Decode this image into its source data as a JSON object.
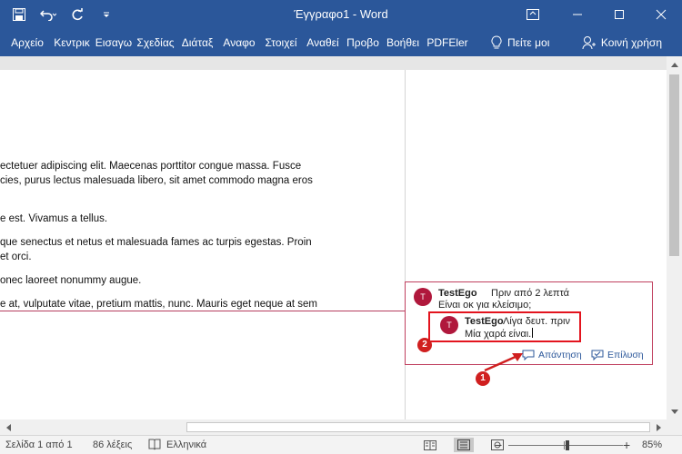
{
  "window": {
    "title": "Έγγραφο1 - Word"
  },
  "ribbon": {
    "tabs": [
      "Αρχείο",
      "Κεντρικ",
      "Εισαγω",
      "Σχεδίας",
      "Διάταξ",
      "Αναφο",
      "Στοιχεί",
      "Αναθεί",
      "Προβο",
      "Βοήθει",
      "PDFEler"
    ],
    "tell_me": "Πείτε μοι",
    "share": "Κοινή χρήση"
  },
  "document": {
    "lines": [
      "ectetuer adipiscing elit. Maecenas porttitor congue massa. Fusce",
      "cies, purus lectus malesuada libero, sit amet commodo magna eros",
      "e est. Vivamus a tellus.",
      "que senectus et netus et malesuada fames ac turpis egestas. Proin",
      " et orci.",
      "onec laoreet nonummy augue.",
      "e at, vulputate vitae, pretium mattis, nunc. Mauris eget neque at sem"
    ]
  },
  "comment": {
    "avatar_initial": "T",
    "author": "TestEgo",
    "time": "Πριν από 2 λεπτά",
    "text": "Είναι οκ για κλείσιμο;",
    "reply": {
      "avatar_initial": "T",
      "author": "TestEgo",
      "time": "Λίγα δευτ. πριν",
      "text": "Μία χαρά είναι."
    },
    "reply_action": "Απάντηση",
    "resolve_action": "Επίλυση"
  },
  "annotations": {
    "badge_1": "1",
    "badge_2": "2",
    "color": "#d01f1f"
  },
  "statusbar": {
    "page": "Σελίδα 1 από 1",
    "words": "86 λέξεις",
    "language": "Ελληνικά",
    "zoom": "85%"
  },
  "colors": {
    "brand": "#2b579a",
    "comment_border": "#c0405f",
    "avatar": "#b0183c"
  }
}
